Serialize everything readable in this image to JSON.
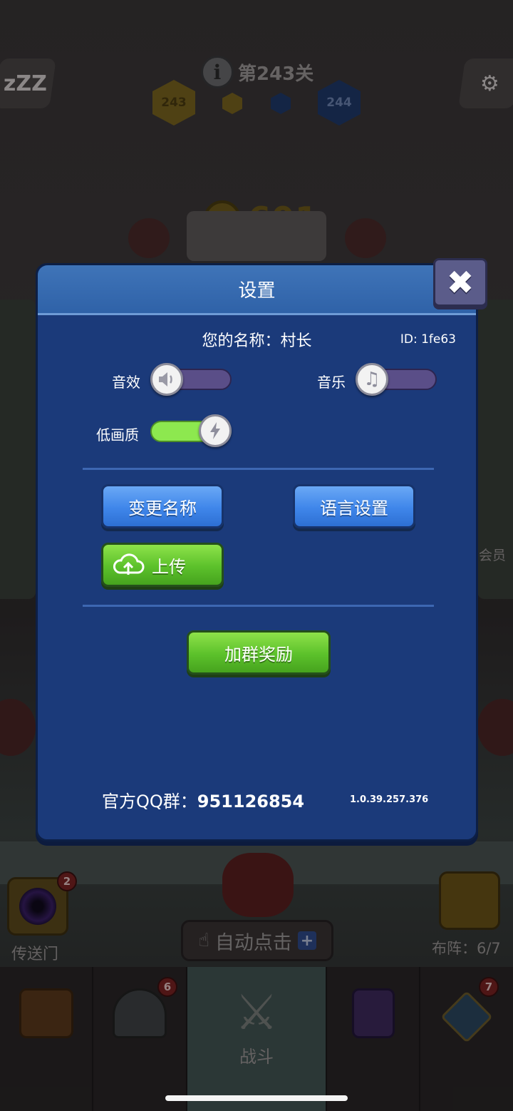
{
  "hud": {
    "sleep_icon_text": "zZZ",
    "info_icon_text": "i",
    "level_title": "第243关",
    "current_level": "243",
    "next_level": "244",
    "coins": "601"
  },
  "settings": {
    "title": "设置",
    "close_symbol": "✖",
    "name_line": "您的名称：村长",
    "id_line": "ID:  1fe63",
    "sound_label": "音效",
    "sound_on": false,
    "music_label": "音乐",
    "music_on": false,
    "low_quality_label": "低画质",
    "low_quality_on": true,
    "rename_button": "变更名称",
    "language_button": "语言设置",
    "upload_button": "上传",
    "join_group_button": "加群奖励",
    "qq_label": "官方QQ群：",
    "qq_number": "951126854",
    "version": "1.0.39.257.376"
  },
  "bottom": {
    "portal_label": "传送门",
    "portal_badge": "2",
    "auto_click_label": "自动点击",
    "auto_click_plus": "+",
    "formation_label": "布阵：6/7",
    "member_label": "会员"
  },
  "nav": {
    "tabs": [
      {
        "name": "chest",
        "label": "",
        "badge": ""
      },
      {
        "name": "helmet",
        "label": "",
        "badge": "6"
      },
      {
        "name": "battle",
        "label": "战斗",
        "badge": ""
      },
      {
        "name": "spellbook",
        "label": "",
        "badge": ""
      },
      {
        "name": "amulet",
        "label": "",
        "badge": "7"
      }
    ]
  },
  "colors": {
    "dialog_bg": "#1b3a7a",
    "dialog_header": "#2f62a8",
    "button_blue": "#3f86ea",
    "button_green": "#5cc12b",
    "toggle_on": "#8de84f",
    "toggle_off": "#5a4e88"
  }
}
